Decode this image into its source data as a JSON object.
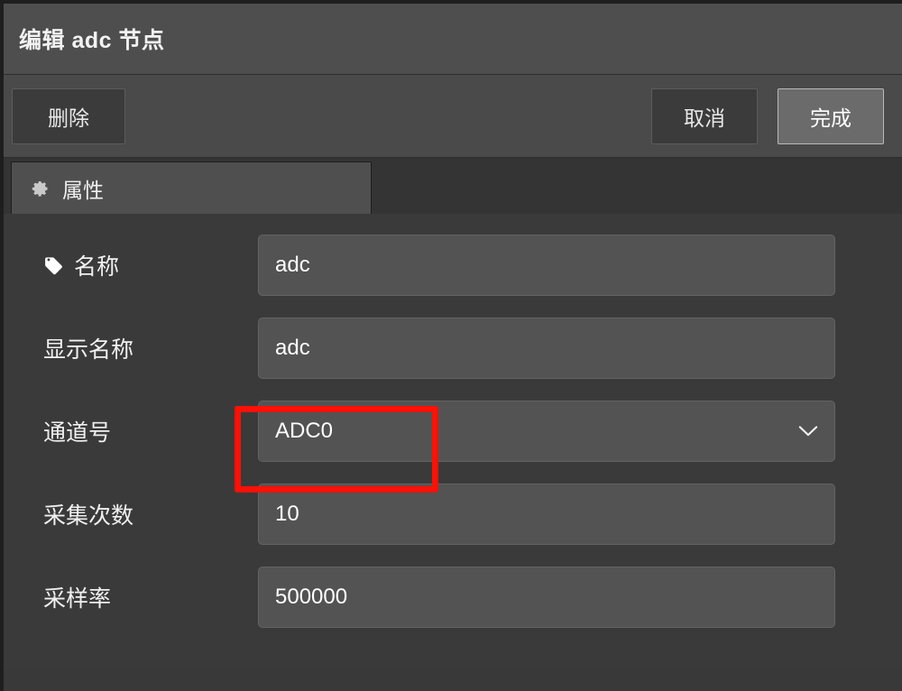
{
  "dialog": {
    "title": "编辑 adc 节点"
  },
  "toolbar": {
    "delete_label": "删除",
    "cancel_label": "取消",
    "done_label": "完成"
  },
  "tabs": [
    {
      "label": "属性",
      "icon": "gear-icon",
      "active": true
    }
  ],
  "form": {
    "rows": [
      {
        "label": "名称",
        "icon": "tag-icon",
        "type": "text",
        "value": "adc"
      },
      {
        "label": "显示名称",
        "icon": null,
        "type": "text",
        "value": "adc"
      },
      {
        "label": "通道号",
        "icon": null,
        "type": "select",
        "value": "ADC0"
      },
      {
        "label": "采集次数",
        "icon": null,
        "type": "text",
        "value": "10"
      },
      {
        "label": "采样率",
        "icon": null,
        "type": "text",
        "value": "500000"
      }
    ]
  },
  "annotation": {
    "type": "highlight-rectangle",
    "color": "#fa1107",
    "target": "通道号"
  },
  "colors": {
    "window_bg": "#393939",
    "header_bg": "#4e4e4e",
    "toolbar_bg": "#4a4a4a",
    "tabstrip_bg": "#343434",
    "tab_active_bg": "#4f4f4f",
    "form_bg": "#3a3a3a",
    "field_bg": "#535353",
    "button_bg": "#3b3b3b",
    "button_primary_bg": "#6b6b6b",
    "text": "#f0f0f0",
    "annotation": "#fa1107"
  }
}
